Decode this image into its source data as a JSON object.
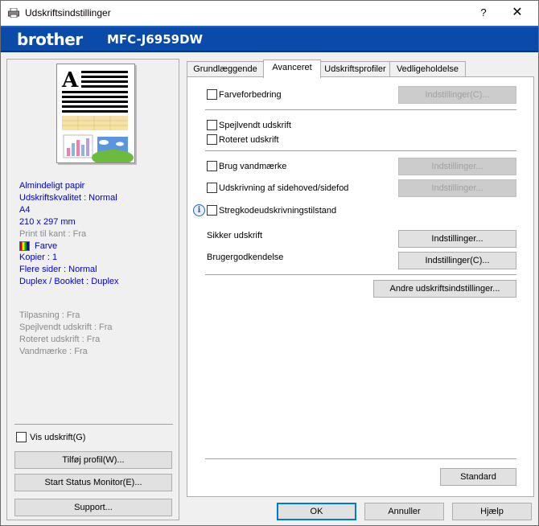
{
  "window": {
    "title": "Udskriftsindstillinger",
    "help_glyph": "?",
    "close_glyph": "✕"
  },
  "banner": {
    "logo": "brother",
    "model": "MFC-J6959DW"
  },
  "summary": {
    "media": "Almindeligt papir",
    "quality": "Udskriftskvalitet : Normal",
    "paper": "A4",
    "size": "210 x 297 mm",
    "borderless": "Print til kant : Fra",
    "color": "Farve",
    "copies": "Kopier : 1",
    "multipage": "Flere sider : Normal",
    "duplex": "Duplex / Booklet : Duplex",
    "fit": "Tilpasning : Fra",
    "mirror": "Spejlvendt udskrift : Fra",
    "rotate": "Roteret udskrift : Fra",
    "watermark": "Vandmærke : Fra"
  },
  "left": {
    "show_print": "Vis udskrift(G)",
    "add_profile": "Tilføj profil(W)...",
    "status_monitor": "Start Status Monitor(E)...",
    "support": "Support..."
  },
  "tabs": [
    "Grundlæggende",
    "Avanceret",
    "Udskriftsprofiler",
    "Vedligeholdelse"
  ],
  "advanced": {
    "color_enhance": "Farveforbedring",
    "settings_c": "Indstillinger(C)...",
    "mirror": "Spejlvendt udskrift",
    "rotate": "Roteret udskrift",
    "watermark": "Brug vandmærke",
    "settings": "Indstillinger...",
    "header_footer": "Udskrivning af sidehoved/sidefod",
    "barcode": "Stregkodeudskrivningstilstand",
    "secure": "Sikker udskrift",
    "user_auth": "Brugergodkendelse",
    "other": "Andre udskriftsindstillinger...",
    "default": "Standard"
  },
  "footer": {
    "ok": "OK",
    "cancel": "Annuller",
    "help": "Hjælp"
  }
}
